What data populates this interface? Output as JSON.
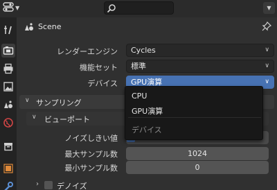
{
  "header": {
    "editor_type_icon": "properties-editor-icon",
    "search": {
      "placeholder": "",
      "value": "",
      "icon": "search-icon"
    },
    "options_icon": "chevron-down-icon"
  },
  "tabs": [
    {
      "name": "tool",
      "icon": "tool-icon",
      "active": false
    },
    {
      "name": "render",
      "icon": "camera-icon",
      "active": true
    },
    {
      "name": "output",
      "icon": "printer-icon",
      "active": false
    },
    {
      "name": "view-layer",
      "icon": "image-icon",
      "active": false
    },
    {
      "name": "scene",
      "icon": "scene-icon",
      "active": false
    },
    {
      "name": "world",
      "icon": "globe-icon",
      "active": false
    },
    {
      "name": "collection",
      "icon": "box-icon",
      "active": false
    },
    {
      "name": "object",
      "icon": "object-icon",
      "active": false
    },
    {
      "name": "modifiers",
      "icon": "wrench-icon",
      "active": false
    }
  ],
  "context": {
    "title": "Scene",
    "icon": "scene-icon",
    "pin_icon": "pin-icon"
  },
  "properties": {
    "render_engine": {
      "label": "レンダーエンジン",
      "value": "Cycles"
    },
    "feature_set": {
      "label": "機能セット",
      "value": "標準"
    },
    "device": {
      "label": "デバイス",
      "value": "GPU演算"
    }
  },
  "sampling": {
    "title": "サンプリング",
    "viewport": {
      "title": "ビューポート",
      "noise_threshold": {
        "label": "ノイズしきい値"
      },
      "max_samples": {
        "label": "最大サンプル数",
        "value": "1024"
      },
      "min_samples": {
        "label": "最小サンプル数",
        "value": "0"
      }
    },
    "denoise": {
      "title": "デノイズ",
      "enabled": false
    }
  },
  "device_popup": {
    "options": [
      "CPU",
      "GPU演算"
    ],
    "caption": "デバイス"
  }
}
